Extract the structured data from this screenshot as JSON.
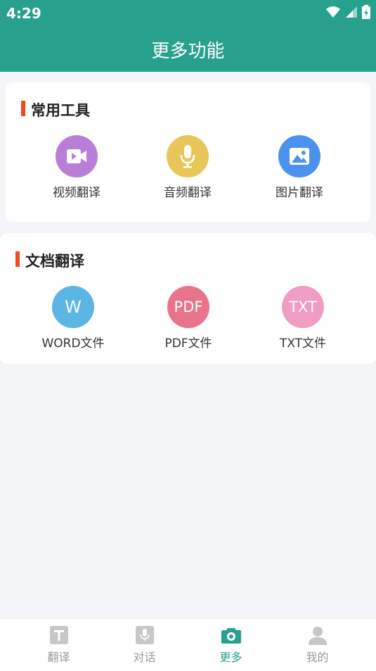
{
  "status_bar": {
    "time": "4:29"
  },
  "header": {
    "title": "更多功能"
  },
  "sections": [
    {
      "title": "常用工具",
      "tools": [
        {
          "label": "视频翻译",
          "icon": "video-icon",
          "color": "#b97fd8"
        },
        {
          "label": "音频翻译",
          "icon": "microphone-icon",
          "color": "#e8c65a"
        },
        {
          "label": "图片翻译",
          "icon": "image-icon",
          "color": "#4b91ee"
        }
      ]
    },
    {
      "title": "文档翻译",
      "tools": [
        {
          "label": "WORD文件",
          "icon_text": "W",
          "color": "#5bb6e3"
        },
        {
          "label": "PDF文件",
          "icon_text": "PDF",
          "color": "#e8748c"
        },
        {
          "label": "TXT文件",
          "icon_text": "TXT",
          "color": "#f09dc4"
        }
      ]
    }
  ],
  "bottom_nav": [
    {
      "label": "翻译",
      "icon": "translate-icon",
      "active": false
    },
    {
      "label": "对话",
      "icon": "microphone-icon",
      "active": false
    },
    {
      "label": "更多",
      "icon": "camera-icon",
      "active": true
    },
    {
      "label": "我的",
      "icon": "user-icon",
      "active": false
    }
  ],
  "colors": {
    "primary": "#27a18e",
    "accent_bar": "#f24a1f"
  }
}
